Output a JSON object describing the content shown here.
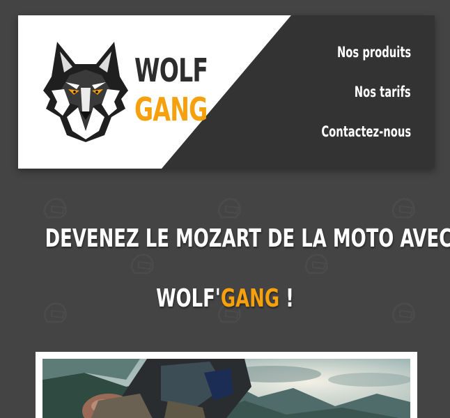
{
  "colors": {
    "background": "#444444",
    "header_dark": "#333333",
    "accent": "#f5a00c",
    "text_light": "#ffffff",
    "text_dark": "#2d2d2d"
  },
  "header": {
    "logo": {
      "icon": "wolf-head-icon",
      "word1": "WOLF",
      "word2": "GANG"
    },
    "nav": [
      {
        "label": "Nos produits"
      },
      {
        "label": "Nos tarifs"
      },
      {
        "label": "Contactez-nous"
      }
    ]
  },
  "hero": {
    "line1": "DEVENEZ LE MOZART DE LA MOTO AVEC",
    "line2_prefix": "WOLF'",
    "line2_accent": "GANG",
    "line2_suffix": " !"
  },
  "background_pattern": {
    "icon": "motorcycle-helmet-icon"
  },
  "photo": {
    "icon": "motorcycle-photo",
    "description_visible": ""
  }
}
